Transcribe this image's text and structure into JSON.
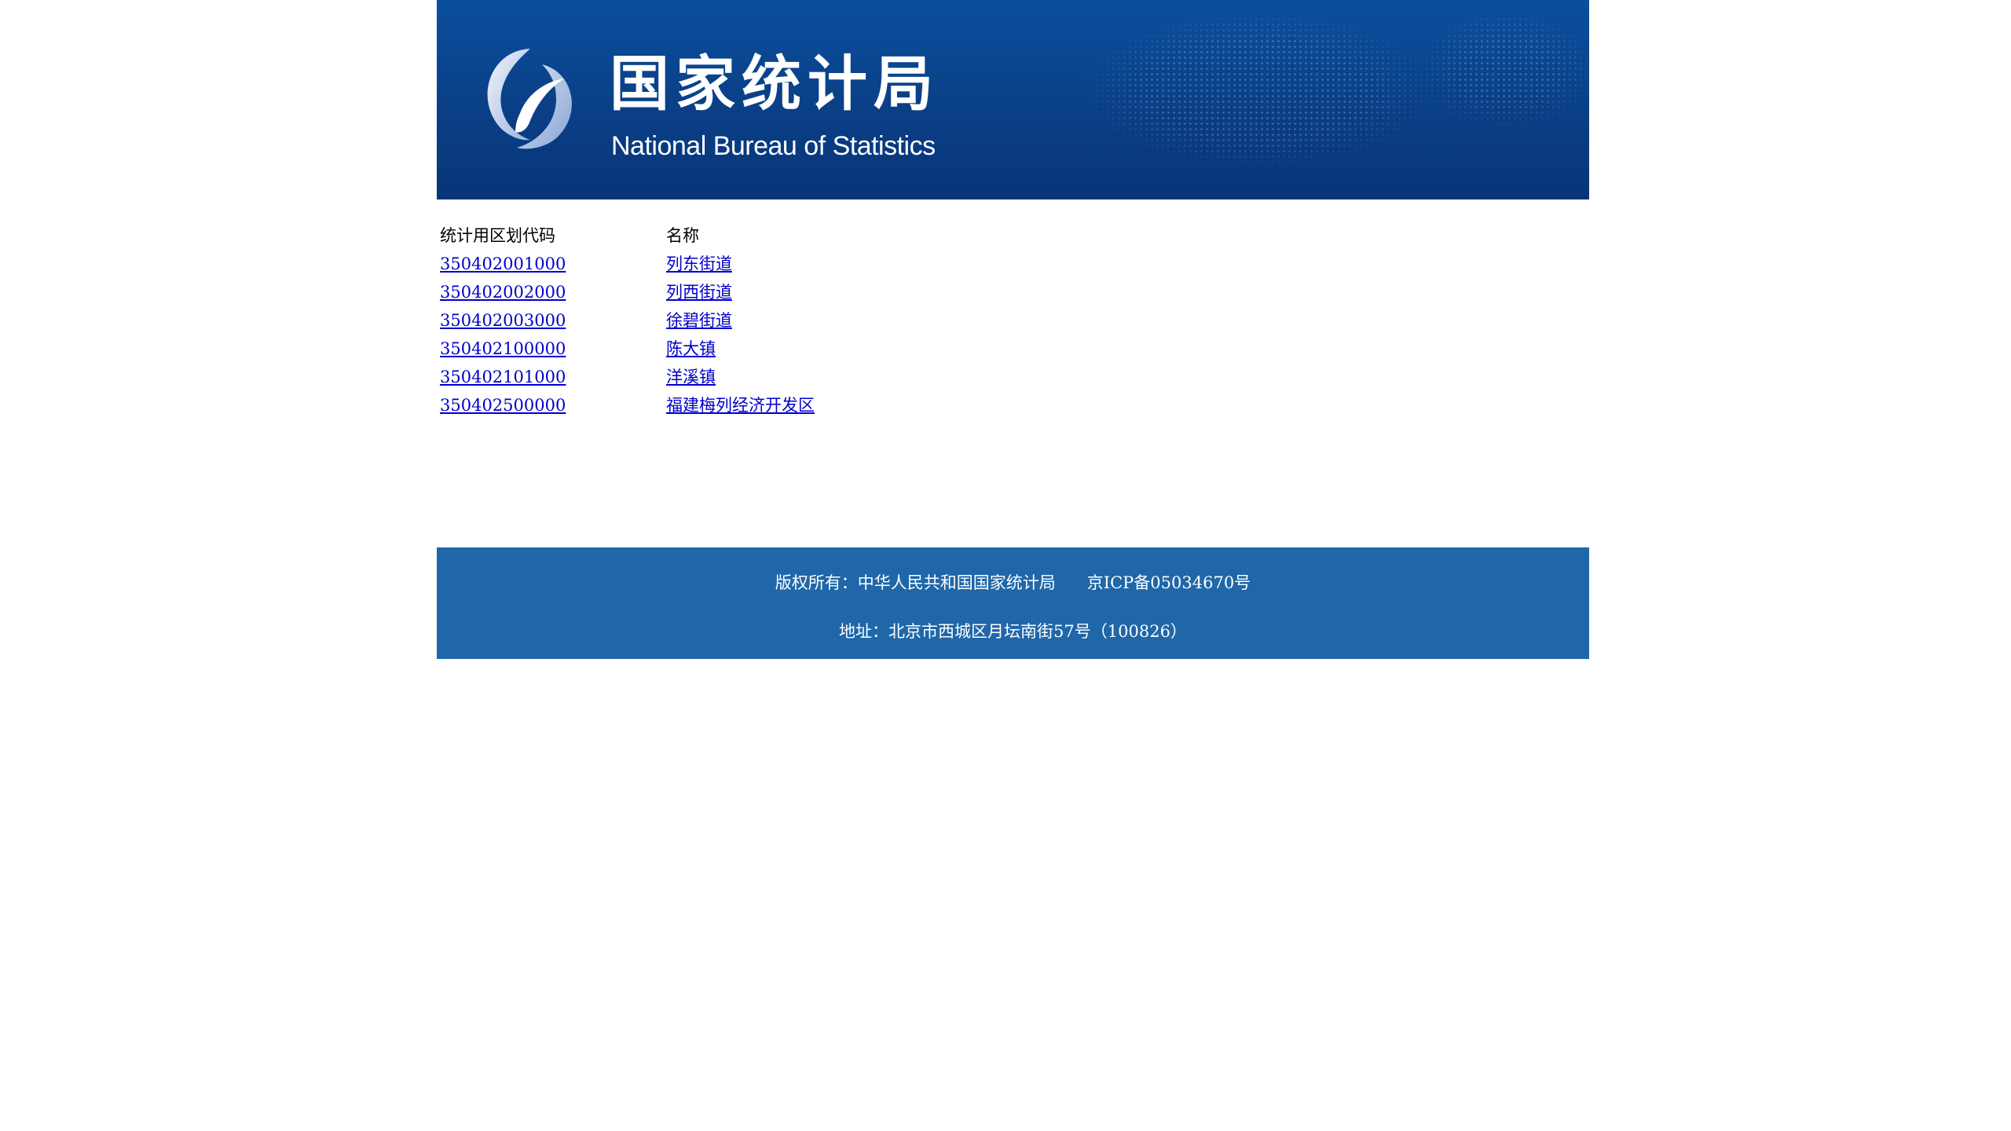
{
  "header": {
    "title_cn": "国家统计局",
    "title_en": "National Bureau of Statistics"
  },
  "table": {
    "columns": [
      "统计用区划代码",
      "名称"
    ],
    "rows": [
      {
        "code": "350402001000",
        "name": "列东街道"
      },
      {
        "code": "350402002000",
        "name": "列西街道"
      },
      {
        "code": "350402003000",
        "name": "徐碧街道"
      },
      {
        "code": "350402100000",
        "name": "陈大镇"
      },
      {
        "code": "350402101000",
        "name": "洋溪镇"
      },
      {
        "code": "350402500000",
        "name": "福建梅列经济开发区"
      }
    ]
  },
  "footer": {
    "copyright": "版权所有：中华人民共和国国家统计局",
    "icp": "京ICP备05034670号",
    "address": "地址：北京市西城区月坛南街57号（100826）"
  },
  "colors": {
    "banner_bg": "#0a3f86",
    "footer_bg": "#1f67a8",
    "link": "#0000cc"
  },
  "icons": {
    "logo": "nbs-logo-icon",
    "map": "world-map-graphic"
  }
}
